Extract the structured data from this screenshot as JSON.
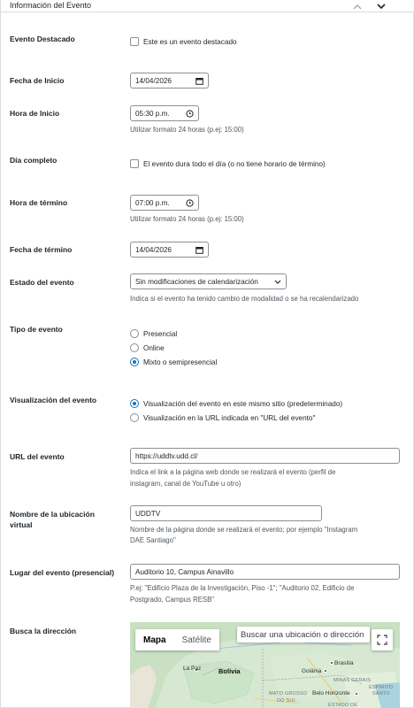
{
  "header": {
    "title": "Información del Evento"
  },
  "fields": {
    "destacado": {
      "label": "Evento Destacado",
      "checkbox_label": "Este es un evento destacado"
    },
    "fecha_inicio": {
      "label": "Fecha de Inicio",
      "value": "14/04/2026"
    },
    "hora_inicio": {
      "label": "Hora de Inicio",
      "value": "05:30 p.m.",
      "help": "Utilizar formato 24 horas (p.ej: 15:00)"
    },
    "dia_completo": {
      "label": "Día completo",
      "checkbox_label": "El evento dura todo el día (o no tiene horario de término)"
    },
    "hora_termino": {
      "label": "Hora de término",
      "value": "07:00 p.m.",
      "help": "Utilizar formato 24 horas (p.ej: 15:00)"
    },
    "fecha_termino": {
      "label": "Fecha de término",
      "value": "14/04/2026"
    },
    "estado": {
      "label": "Estado del evento",
      "selected": "Sin modificaciones de calendarización",
      "help": "Indica si el evento ha tenido cambio de modalidad o se ha recalendarizado"
    },
    "tipo": {
      "label": "Tipo de evento",
      "options": [
        "Presencial",
        "Online",
        "Mixto o semipresencial"
      ],
      "selected": "Mixto o semipresencial"
    },
    "visualizacion": {
      "label": "Visualización del evento",
      "options": [
        "Visualización del evento en este mismo sitio (predeterminado)",
        "Visualización en la URL indicada en \"URL del evento\""
      ],
      "selected": "Visualización del evento en este mismo sitio (predeterminado)"
    },
    "url": {
      "label": "URL del evento",
      "value": "https://uddtv.udd.cl/",
      "help_line1": "Indica el link a la página web donde se realizará el evento (perfil de",
      "help_line2": "instagram, canal de YouTube u otro)"
    },
    "ubicacion": {
      "label_line1": "Nombre de la ubicación",
      "label_line2": "virtual",
      "value": "UDDTV",
      "help_line1": "Nombre de la página donde se realizará el evento; por ejemplo \"Instagram",
      "help_line2": "DAE Santiago\""
    },
    "lugar": {
      "label": "Lugar del evento (presencial)",
      "value": "Auditorio 10, Campus Ainavillo",
      "help_line1": "P.ej: \"Edificio Plaza de la Investigación, Piso -1\"; \"Auditorio 02, Edificio de",
      "help_line2": "Postgrado, Campus RESB\""
    },
    "direccion": {
      "label": "Busca la dirección"
    }
  },
  "map": {
    "tab_map": "Mapa",
    "tab_satellite": "Satélite",
    "search_placeholder": "Buscar una ubicación o dirección",
    "labels": {
      "bolivia": "Bolivia",
      "la_paz": "La Paz",
      "brasilia": "Brasília",
      "goiania": "Goiânia",
      "belo_horizonte": "Belo Horizonte",
      "minas_gerais": "MINAS GERAIS",
      "mato_grosso": "MATO GROSSO",
      "do_sul": "DO SUL",
      "espirito": "ESPÍRITO",
      "santo": "SANTO",
      "estado_de": "ESTADO DE"
    }
  },
  "colors": {
    "accent": "#2271b1",
    "border": "#8c8f94",
    "help_text": "#50575e"
  }
}
